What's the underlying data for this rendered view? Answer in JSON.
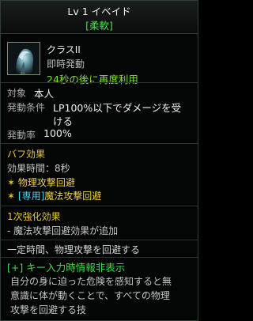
{
  "header": {
    "skill_name": "Lv 1 イベイド",
    "skill_type": "[柔軟]"
  },
  "skill": {
    "icon": "class-portrait-icon",
    "class_name": "クラスII",
    "activation": "即時発動",
    "cooldown": "24秒の後に再度利用"
  },
  "info": {
    "target_label": "対象",
    "target_value": "本人",
    "condition_label": "発動条件",
    "condition_value_line1": "LP100%以下でダメージを受",
    "condition_value_line2": "ける",
    "rate_label": "発動率",
    "rate_value": "100%"
  },
  "buff": {
    "title": "バフ効果",
    "duration": "効果時間：8秒",
    "effect1": "物理攻撃回避",
    "effect2_tag": "[専用]",
    "effect2": "魔法攻撃回避"
  },
  "enhance": {
    "title": "1次強化効果",
    "item": "- 魔法攻撃回避効果が追加"
  },
  "summary": "一定時間、物理攻撃を回避する",
  "key_hint": "[+] キー入力時情報非表示",
  "description": {
    "line1": "自分の身に迫った危険を感知すると無",
    "line2": "意識に体が動くことで、すべての物理",
    "line3": "攻撃を回避する技"
  },
  "colors": {
    "title_green": "#46e646",
    "cooldown_green": "#7fe23a",
    "section_yellow": "#e8c838",
    "label_gray": "#a9a9a9"
  }
}
